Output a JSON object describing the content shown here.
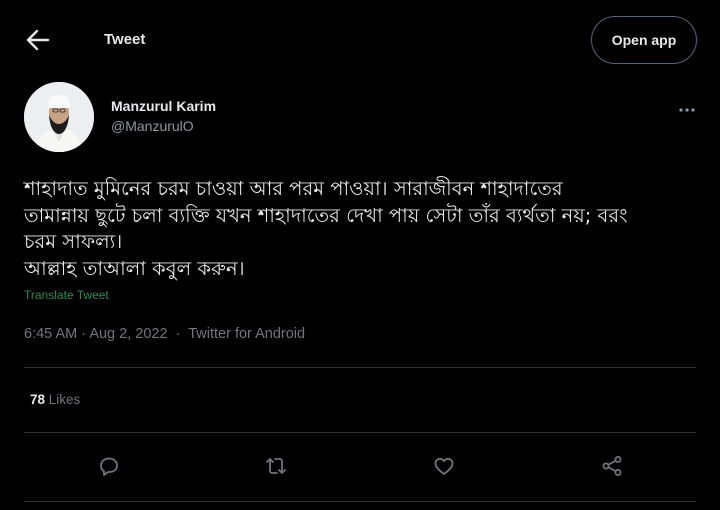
{
  "header": {
    "title": "Tweet",
    "open_app_label": "Open app"
  },
  "author": {
    "name": "Manzurul Karim",
    "handle": "@ManzurulO"
  },
  "tweet": {
    "lines": [
      "শাহাদাত মুমিনের চরম চাওয়া আর পরম পাওয়া। সারাজীবন শাহাদাতের",
      "তামান্নায় ছুটে চলা ব্যক্তি যখন শাহাদাতের দেখা পায় সেটা তাঁর ব্যর্থতা নয়; বরং",
      "চরম সাফল্য।",
      "আল্লাহ তাআলা কবুল করুন।"
    ],
    "translate_label": "Translate Tweet"
  },
  "meta": {
    "time": "6:45 AM",
    "date": "Aug 2, 2022",
    "separator": "·",
    "source": "Twitter for Android"
  },
  "stats": {
    "likes_count": "78",
    "likes_label": "Likes"
  },
  "icons": {
    "back": "arrow-left-icon",
    "more": "more-horizontal-icon",
    "reply": "reply-icon",
    "retweet": "retweet-icon",
    "like": "heart-icon",
    "share": "share-icon"
  },
  "colors": {
    "background": "#000000",
    "text": "#e7e9ea",
    "muted": "#71767b",
    "translate": "#2d8a5b",
    "divider": "#2f3336"
  }
}
